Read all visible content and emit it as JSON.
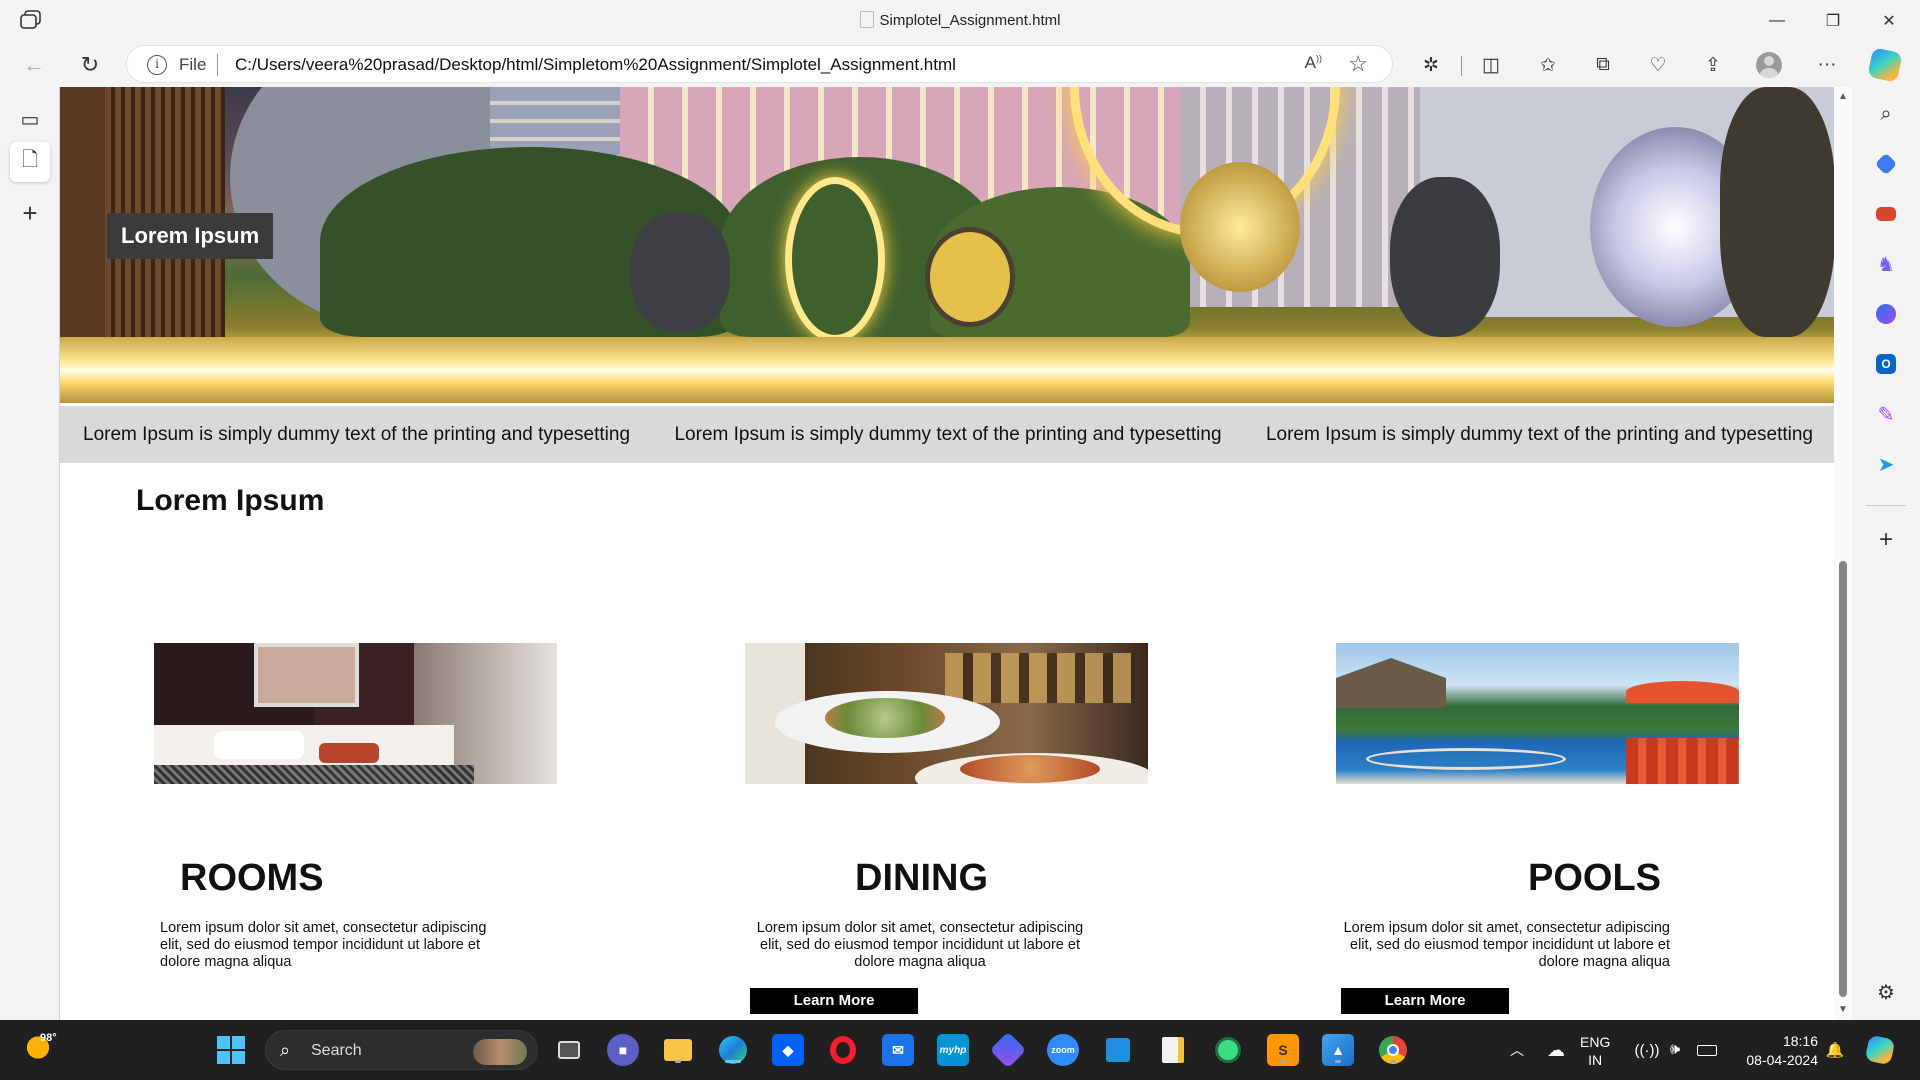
{
  "window": {
    "title": "Simplotel_Assignment.html",
    "minimize": "—",
    "maximize": "❐",
    "close": "✕"
  },
  "address_bar": {
    "scheme_label": "File",
    "url": "C:/Users/veera%20prasad/Desktop/html/Simpletom%20Assignment/Simplotel_Assignment.html"
  },
  "page": {
    "hero_label": "Lorem Ipsum",
    "banner_items": [
      "Lorem Ipsum is simply dummy text of the printing and typesetting",
      "Lorem Ipsum is simply dummy text of the printing and typesetting",
      "Lorem Ipsum is simply dummy text of the printing and typesetting"
    ],
    "section_title": "Lorem Ipsum",
    "cards": [
      {
        "title": "ROOMS",
        "text": "Lorem ipsum dolor sit amet, consectetur adipiscing elit, sed do eiusmod tempor incididunt ut labore et dolore magna aliqua"
      },
      {
        "title": "DINING",
        "text": "Lorem ipsum dolor sit amet, consectetur adipiscing elit, sed do eiusmod tempor incididunt ut labore et dolore magna aliqua",
        "button": "Learn More"
      },
      {
        "title": "POOLS",
        "text": "Lorem ipsum dolor sit amet, consectetur adipiscing elit, sed do eiusmod tempor incididunt ut labore et dolore magna aliqua",
        "button": "Learn More"
      }
    ]
  },
  "taskbar": {
    "weather_temp": "98°",
    "search_label": "Search",
    "lang_line1": "ENG",
    "lang_line2": "IN",
    "time": "18:16",
    "date": "08-04-2024"
  },
  "colors": {
    "taskbar_bg": "#202020",
    "browser_chrome": "#f3f3f3",
    "banner_bg": "#d9d9d9",
    "button_bg": "#000000"
  }
}
